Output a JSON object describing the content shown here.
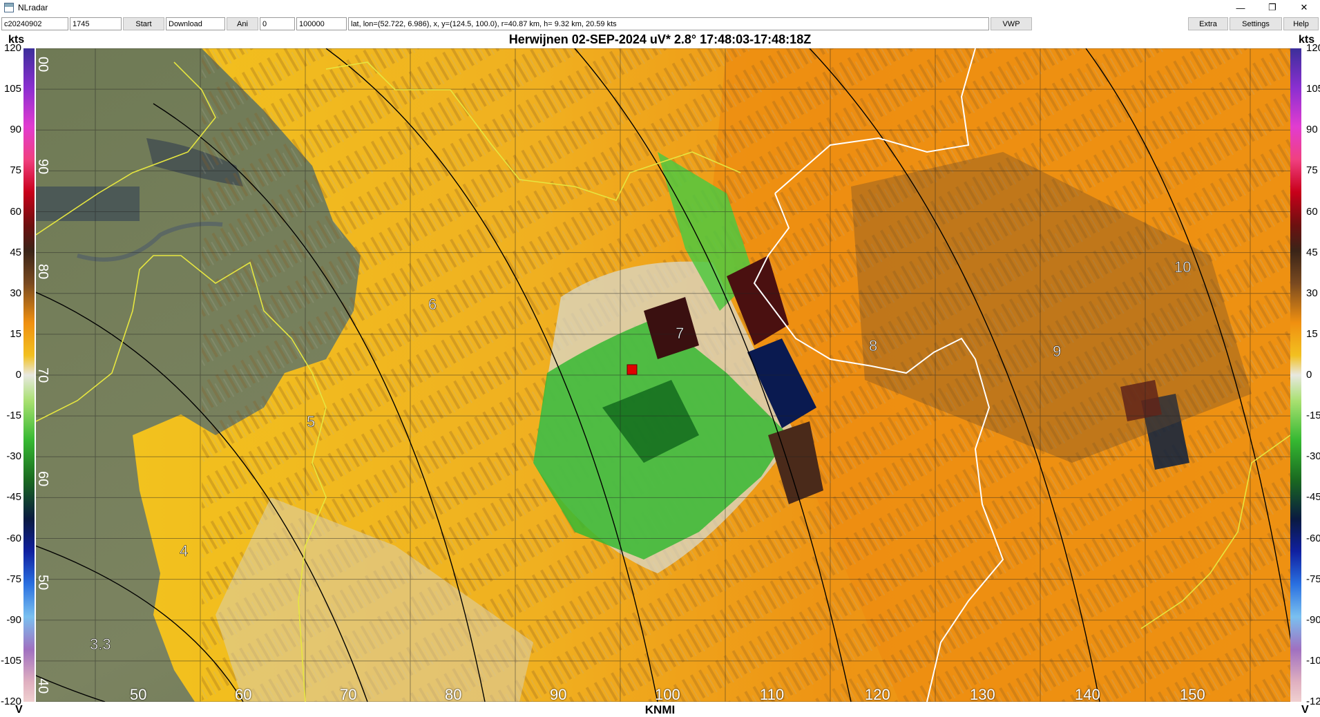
{
  "window": {
    "title": "NLradar",
    "minimize_icon": "—",
    "restore_icon": "❐",
    "close_icon": "✕"
  },
  "toolbar": {
    "date_value": "c20240902",
    "time_value": "1745",
    "start_label": "Start",
    "download_value": "Download",
    "ani_label": "Ani",
    "field1_value": "0",
    "field2_value": "100000",
    "info_value": "lat, lon=(52.722, 6.986),  x, y=(124.5, 100.0),  r=40.87 km,  h= 9.32 km, 20.59 kts",
    "vwp_label": "VWP",
    "extra_label": "Extra",
    "settings_label": "Settings",
    "help_label": "Help"
  },
  "header": {
    "title": "Herwijnen  02-SEP-2024     uV* 2.8°  17:48:03-17:48:18Z",
    "unit_left": "kts",
    "unit_right": "kts"
  },
  "footer": {
    "left_label": "V",
    "center_label": "KNMI",
    "right_label": "V"
  },
  "y_ticks": [
    "120",
    "105",
    "90",
    "75",
    "60",
    "45",
    "30",
    "15",
    "0",
    "-15",
    "-30",
    "-45",
    "-60",
    "-75",
    "-90",
    "-105",
    "-120"
  ],
  "x_ticks": [
    "50",
    "60",
    "70",
    "80",
    "90",
    "100",
    "110",
    "120",
    "130",
    "140",
    "150"
  ],
  "range_labels": [
    "3.3",
    "4",
    "5",
    "6",
    "7",
    "8",
    "9",
    "10"
  ],
  "colorbar_labels": [
    "00",
    "90",
    "80",
    "70",
    "60",
    "50",
    "40"
  ],
  "colors": {
    "accent_yellow": "#e8c41a",
    "accent_orange": "#f09010",
    "velocity_green": "#36b832",
    "velocity_dark": "#4a2a1a",
    "marker_red": "#e00000",
    "boundary_white": "#ffffff",
    "boundary_yellow": "#e6e640"
  },
  "icons": {
    "app": "radar-app-icon",
    "marker": "red-square-marker"
  }
}
